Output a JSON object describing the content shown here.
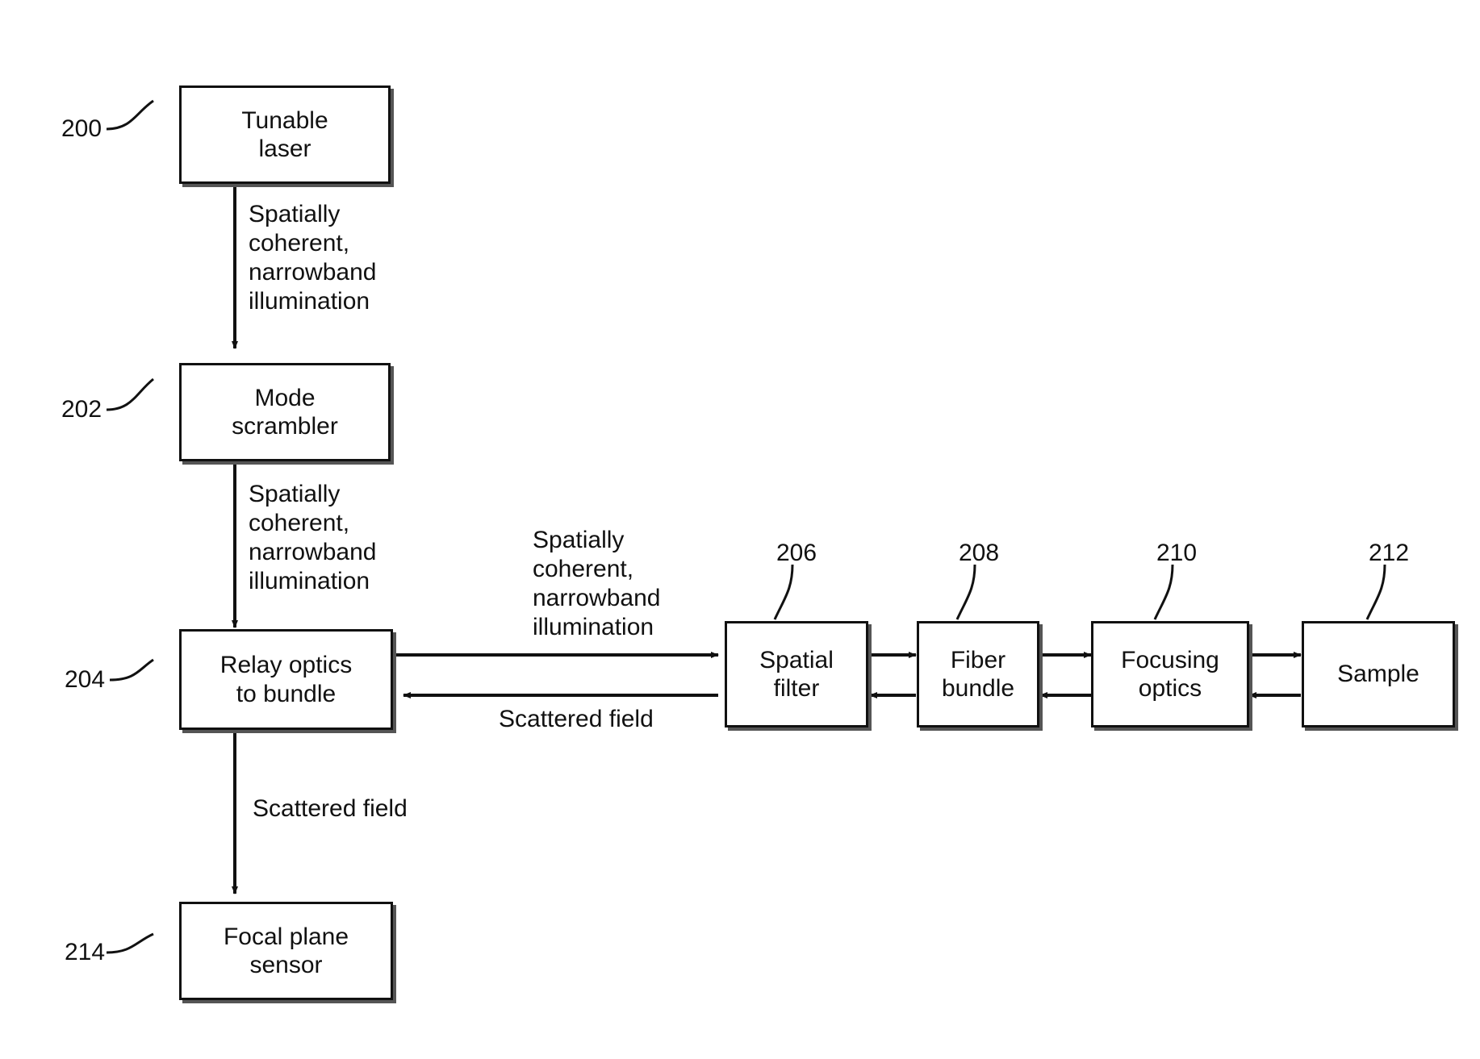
{
  "figure": {
    "type": "block-diagram",
    "title": "",
    "nodes": [
      {
        "id": "tunable-laser",
        "ref": "200",
        "label": "Tunable\nlaser"
      },
      {
        "id": "mode-scrambler",
        "ref": "202",
        "label": "Mode\nscrambler"
      },
      {
        "id": "relay-optics",
        "ref": "204",
        "label": "Relay optics\nto bundle"
      },
      {
        "id": "spatial-filter",
        "ref": "206",
        "label": "Spatial\nfilter"
      },
      {
        "id": "fiber-bundle",
        "ref": "208",
        "label": "Fiber\nbundle"
      },
      {
        "id": "focusing-optics",
        "ref": "210",
        "label": "Focusing\noptics"
      },
      {
        "id": "sample",
        "ref": "212",
        "label": "Sample"
      },
      {
        "id": "focal-plane-sensor",
        "ref": "214",
        "label": "Focal plane\nsensor"
      }
    ],
    "edge_labels": [
      {
        "id": "laser-to-scrambler",
        "text": "Spatially\ncoherent,\nnarrowband\nillumination"
      },
      {
        "id": "scrambler-to-relay",
        "text": "Spatially\ncoherent,\nnarrowband\nillumination"
      },
      {
        "id": "relay-to-filter",
        "text": "Spatially\ncoherent,\nnarrowband\nillumination"
      },
      {
        "id": "filter-to-relay",
        "text": "Scattered field"
      },
      {
        "id": "relay-to-sensor",
        "text": "Scattered field"
      }
    ]
  }
}
